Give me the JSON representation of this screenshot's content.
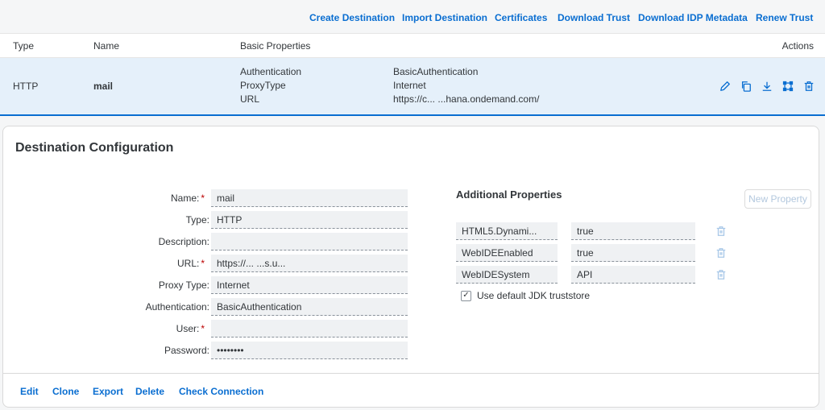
{
  "toolbar": {
    "create": "Create Destination",
    "import": "Import Destination",
    "certificates": "Certificates",
    "download_trust": "Download Trust",
    "download_idp": "Download IDP Metadata",
    "renew_trust": "Renew Trust"
  },
  "table": {
    "headers": {
      "type": "Type",
      "name": "Name",
      "basic": "Basic Properties",
      "actions": "Actions"
    },
    "row": {
      "type": "HTTP",
      "name": "mail",
      "props": [
        "Authentication",
        "ProxyType",
        "URL"
      ],
      "values": [
        "BasicAuthentication",
        "Internet",
        "https://c...      ...hana.ondemand.com/"
      ]
    },
    "action_icons": [
      "edit-icon",
      "copy-icon",
      "download-icon",
      "network-icon",
      "delete-icon"
    ]
  },
  "config": {
    "title": "Destination Configuration",
    "form": {
      "name_label": "Name:",
      "name_value": "mail",
      "type_label": "Type:",
      "type_value": "HTTP",
      "description_label": "Description:",
      "description_value": "",
      "url_label": "URL:",
      "url_value": "https://...          ...s.u...",
      "proxy_label": "Proxy Type:",
      "proxy_value": "Internet",
      "auth_label": "Authentication:",
      "auth_value": "BasicAuthentication",
      "user_label": "User:",
      "user_value": "",
      "password_label": "Password:",
      "password_value": "••••••••"
    },
    "additional": {
      "title": "Additional Properties",
      "new_property": "New Property",
      "rows": [
        {
          "key": "HTML5.Dynami...",
          "value": "true"
        },
        {
          "key": "WebIDEEnabled",
          "value": "true"
        },
        {
          "key": "WebIDESystem",
          "value": "API"
        }
      ],
      "checkbox_label": "Use default JDK truststore",
      "checkbox_checked": true
    },
    "footer": {
      "edit": "Edit",
      "clone": "Clone",
      "export": "Export",
      "delete": "Delete",
      "check": "Check Connection"
    }
  },
  "colors": {
    "accent": "#0a6ed1",
    "selected_row": "#e5f0fa",
    "required": "#bb0000"
  }
}
